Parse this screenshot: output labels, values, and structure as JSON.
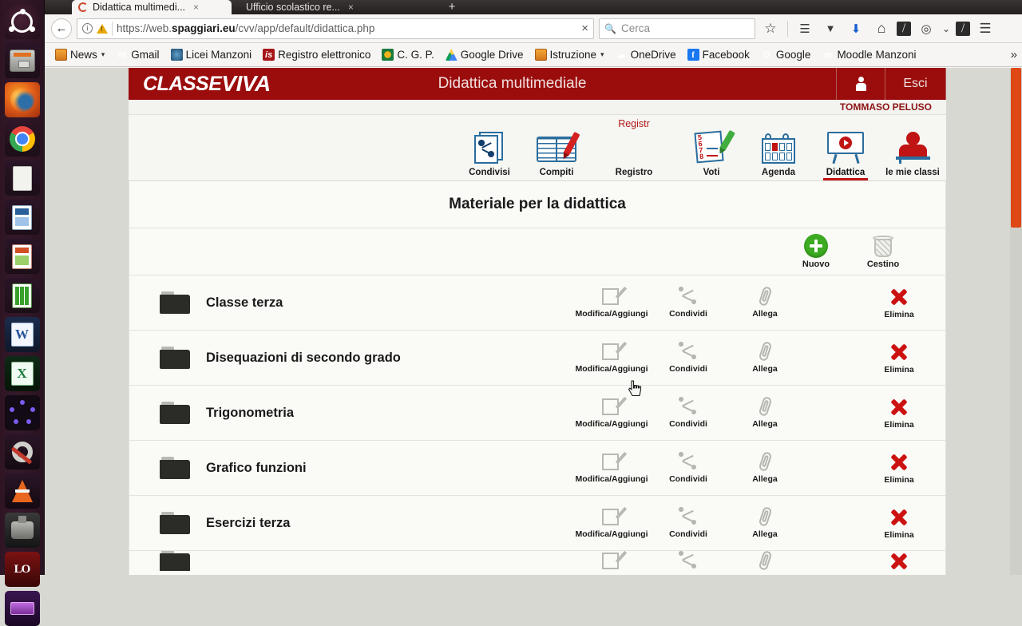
{
  "launcher": {
    "items": [
      {
        "name": "ubuntu-dash",
        "label": "Ubuntu Dash"
      },
      {
        "name": "files",
        "label": "Files"
      },
      {
        "name": "firefox",
        "label": "Firefox"
      },
      {
        "name": "chrome",
        "label": "Google Chrome"
      },
      {
        "name": "libreoffice-writer",
        "label": "LibreOffice Writer"
      },
      {
        "name": "libreoffice-draw",
        "label": "LibreOffice Draw"
      },
      {
        "name": "libreoffice-impress",
        "label": "LibreOffice Impress"
      },
      {
        "name": "libreoffice-calc",
        "label": "LibreOffice Calc"
      },
      {
        "name": "microsoft-word",
        "label": "Microsoft Word",
        "glyph": "W"
      },
      {
        "name": "microsoft-excel",
        "label": "Microsoft Excel",
        "glyph": "X"
      },
      {
        "name": "loading-app",
        "label": "Loading"
      },
      {
        "name": "system-settings",
        "label": "System Settings"
      },
      {
        "name": "vlc",
        "label": "VLC Media Player"
      },
      {
        "name": "game",
        "label": "Game"
      },
      {
        "name": "logizen",
        "label": "LO"
      },
      {
        "name": "other-app",
        "label": "Other"
      }
    ]
  },
  "browser": {
    "tabs": [
      {
        "title": "Didattica multimedi...",
        "active": true,
        "close": "×"
      },
      {
        "title": "Ufficio scolastico re...",
        "active": false,
        "close": "×"
      }
    ],
    "newtab_glyph": "+",
    "back_glyph": "←",
    "url": {
      "prefix": "https://web.",
      "domain": "spaggiari.eu",
      "suffix": "/cvv/app/default/didattica.php",
      "full": "https://web.spaggiari.eu/cvv/app/default/didattica.php",
      "stop_glyph": "×"
    },
    "search": {
      "placeholder": "Cerca",
      "icon": "search-icon"
    },
    "toolbar_icons": [
      {
        "name": "bookmark-star-icon",
        "glyph": "☆"
      },
      {
        "name": "reader-library-icon",
        "glyph": "☰"
      },
      {
        "name": "pocket-icon",
        "glyph": "▼"
      },
      {
        "name": "downloads-icon",
        "glyph": "⬇"
      },
      {
        "name": "home-icon",
        "glyph": "⌂"
      },
      {
        "name": "extension-icon",
        "glyph": "⧸"
      },
      {
        "name": "chat-bubble-icon",
        "glyph": "◎"
      },
      {
        "name": "chevron-down-icon",
        "glyph": "⌄"
      },
      {
        "name": "extension-2-icon",
        "glyph": "⧸"
      },
      {
        "name": "hamburger-menu-icon",
        "glyph": "☰"
      }
    ],
    "bookmarks": [
      {
        "label": "News",
        "icon": "folder-icon",
        "has_caret": true
      },
      {
        "label": "Gmail",
        "icon": "gmail-icon",
        "glyph": "M"
      },
      {
        "label": "Licei Manzoni",
        "icon": "licei-manzoni-icon"
      },
      {
        "label": "Registro elettronico",
        "icon": "registro-elettronico-icon",
        "glyph": "is"
      },
      {
        "label": "C. G. P.",
        "icon": "cgp-icon"
      },
      {
        "label": "Google Drive",
        "icon": "google-drive-icon"
      },
      {
        "label": "Istruzione",
        "icon": "folder-icon",
        "has_caret": true
      },
      {
        "label": "OneDrive",
        "icon": "onedrive-icon",
        "glyph": "☁"
      },
      {
        "label": "Facebook",
        "icon": "facebook-icon",
        "glyph": "f"
      },
      {
        "label": "Google",
        "icon": "google-icon",
        "glyph": "G"
      },
      {
        "label": "Moodle Manzoni",
        "icon": "moodle-icon",
        "glyph": "m"
      }
    ],
    "bookmarks_overflow": "»"
  },
  "app": {
    "logo_part1": "CLASSE",
    "logo_part2": "VIVA",
    "header_title": "Didattica multimediale",
    "logout_label": "Esci",
    "username": "TOMMASO PELUSO",
    "nav": [
      {
        "label": "Condivisi",
        "icon": "condivisi-icon",
        "selected": false,
        "sublabel": ""
      },
      {
        "label": "Compiti",
        "icon": "compiti-icon",
        "selected": false,
        "sublabel": ""
      },
      {
        "label": "Registro",
        "icon": "registro-icon",
        "selected": false,
        "sublabel": "Registr"
      },
      {
        "label": "Voti",
        "icon": "voti-icon",
        "selected": false,
        "sublabel": ""
      },
      {
        "label": "Agenda",
        "icon": "agenda-icon",
        "selected": false,
        "sublabel": ""
      },
      {
        "label": "Didattica",
        "icon": "didattica-icon",
        "selected": true,
        "sublabel": ""
      },
      {
        "label": "le mie classi",
        "icon": "le-mie-classi-icon",
        "selected": false,
        "sublabel": ""
      }
    ],
    "page_title": "Materiale per la didattica",
    "actions": [
      {
        "label": "Nuovo",
        "icon": "plus-icon"
      },
      {
        "label": "Cestino",
        "icon": "trash-icon"
      }
    ],
    "row_actions": [
      {
        "label": "Modifica/Aggiungi",
        "icon": "edit-icon"
      },
      {
        "label": "Condividi",
        "icon": "share-icon"
      },
      {
        "label": "Allega",
        "icon": "paperclip-icon"
      },
      {
        "label": "Elimina",
        "icon": "delete-x-icon"
      }
    ],
    "folders": [
      {
        "name": "Classe terza"
      },
      {
        "name": "Disequazioni di secondo grado"
      },
      {
        "name": "Trigonometria"
      },
      {
        "name": "Grafico funzioni"
      },
      {
        "name": "Esercizi terza"
      },
      {
        "name": ""
      }
    ]
  },
  "colors": {
    "brand_red": "#9b0d0d",
    "accent_red": "#c01414",
    "add_green": "#3caa22",
    "scrollbar_orange": "#dd4814",
    "panel_bg": "#fafaf7"
  }
}
